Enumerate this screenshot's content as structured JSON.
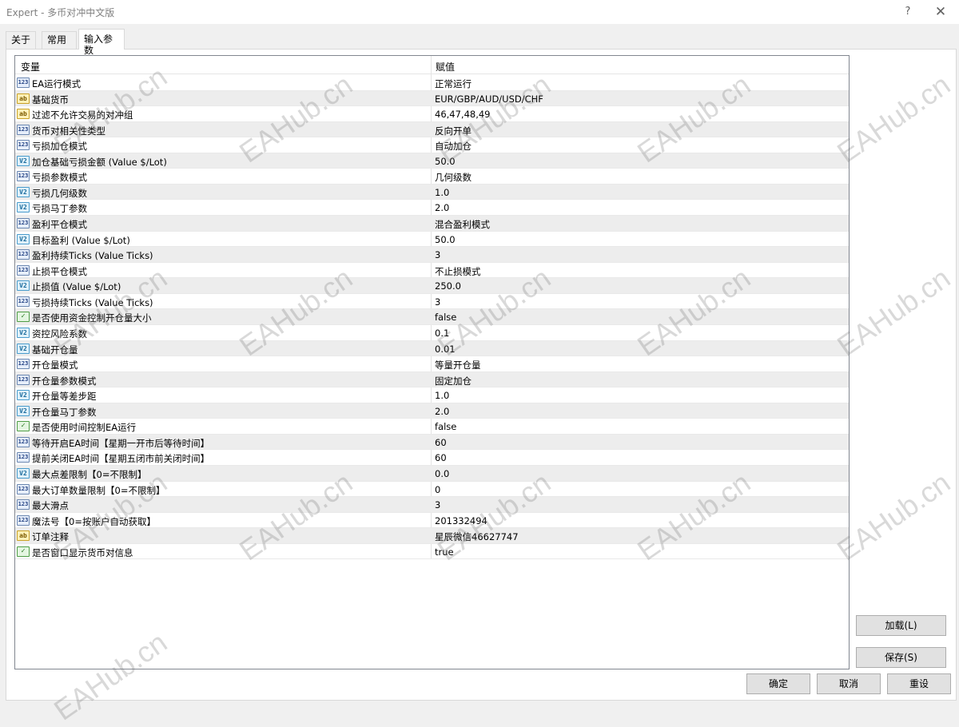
{
  "window": {
    "title": "Expert - 多币对冲中文版",
    "help_glyph": "?",
    "close_glyph": "✕"
  },
  "tabs": [
    {
      "label": "关于"
    },
    {
      "label": "常用"
    },
    {
      "label": "输入参数"
    }
  ],
  "table": {
    "col_variable": "变量",
    "col_value": "赋值",
    "rows": [
      {
        "type": "int",
        "icon": "123",
        "name": "EA运行模式",
        "value": "正常运行"
      },
      {
        "type": "string",
        "icon": "ab",
        "name": "基础货币",
        "value": "EUR/GBP/AUD/USD/CHF"
      },
      {
        "type": "string",
        "icon": "ab",
        "name": "过滤不允许交易的对冲组",
        "value": "46,47,48,49"
      },
      {
        "type": "int",
        "icon": "123",
        "name": "货币对相关性类型",
        "value": "反向开单"
      },
      {
        "type": "int",
        "icon": "123",
        "name": "亏损加仓模式",
        "value": "自动加仓"
      },
      {
        "type": "double",
        "icon": "V2",
        "name": "加仓基础亏损金额 (Value $/Lot)",
        "value": "50.0"
      },
      {
        "type": "int",
        "icon": "123",
        "name": "亏损参数模式",
        "value": "几何级数"
      },
      {
        "type": "double",
        "icon": "V2",
        "name": "亏损几何级数",
        "value": "1.0"
      },
      {
        "type": "double",
        "icon": "V2",
        "name": "亏损马丁参数",
        "value": "2.0"
      },
      {
        "type": "int",
        "icon": "123",
        "name": "盈利平仓模式",
        "value": "混合盈利模式"
      },
      {
        "type": "double",
        "icon": "V2",
        "name": "目标盈利 (Value $/Lot)",
        "value": "50.0"
      },
      {
        "type": "int",
        "icon": "123",
        "name": "盈利持续Ticks (Value Ticks)",
        "value": "3"
      },
      {
        "type": "int",
        "icon": "123",
        "name": "止损平仓模式",
        "value": "不止损模式"
      },
      {
        "type": "double",
        "icon": "V2",
        "name": "止损值 (Value $/Lot)",
        "value": "250.0"
      },
      {
        "type": "int",
        "icon": "123",
        "name": "亏损持续Ticks (Value Ticks)",
        "value": "3"
      },
      {
        "type": "bool",
        "icon": "✓",
        "name": "是否使用资金控制开仓量大小",
        "value": "false"
      },
      {
        "type": "double",
        "icon": "V2",
        "name": "资控风险系数",
        "value": "0.1"
      },
      {
        "type": "double",
        "icon": "V2",
        "name": "基础开仓量",
        "value": "0.01"
      },
      {
        "type": "int",
        "icon": "123",
        "name": "开仓量模式",
        "value": "等量开仓量"
      },
      {
        "type": "int",
        "icon": "123",
        "name": "开仓量参数模式",
        "value": "固定加仓"
      },
      {
        "type": "double",
        "icon": "V2",
        "name": "开仓量等差步距",
        "value": "1.0"
      },
      {
        "type": "double",
        "icon": "V2",
        "name": "开仓量马丁参数",
        "value": "2.0"
      },
      {
        "type": "bool",
        "icon": "✓",
        "name": "是否使用时间控制EA运行",
        "value": "false"
      },
      {
        "type": "int",
        "icon": "123",
        "name": "等待开启EA时间【星期一开市后等待时间】",
        "value": "60"
      },
      {
        "type": "int",
        "icon": "123",
        "name": "提前关闭EA时间【星期五闭市前关闭时间】",
        "value": "60"
      },
      {
        "type": "double",
        "icon": "V2",
        "name": "最大点差限制【0=不限制】",
        "value": "0.0"
      },
      {
        "type": "int",
        "icon": "123",
        "name": "最大订单数量限制【0=不限制】",
        "value": "0"
      },
      {
        "type": "int",
        "icon": "123",
        "name": "最大滑点",
        "value": "3"
      },
      {
        "type": "int",
        "icon": "123",
        "name": "魔法号【0=按账户自动获取】",
        "value": "201332494"
      },
      {
        "type": "string",
        "icon": "ab",
        "name": "订单注释",
        "value": "星辰微信46627747"
      },
      {
        "type": "bool",
        "icon": "✓",
        "name": "是否窗口显示货币对信息",
        "value": "true"
      }
    ]
  },
  "buttons": {
    "load": "加载(L)",
    "save": "保存(S)",
    "ok": "确定",
    "cancel": "取消",
    "reset": "重设"
  },
  "watermark": "EAHub.cn",
  "colors": {
    "table_border": "#828790",
    "row_alt": "#ededed",
    "button_face": "#e1e1e1"
  }
}
